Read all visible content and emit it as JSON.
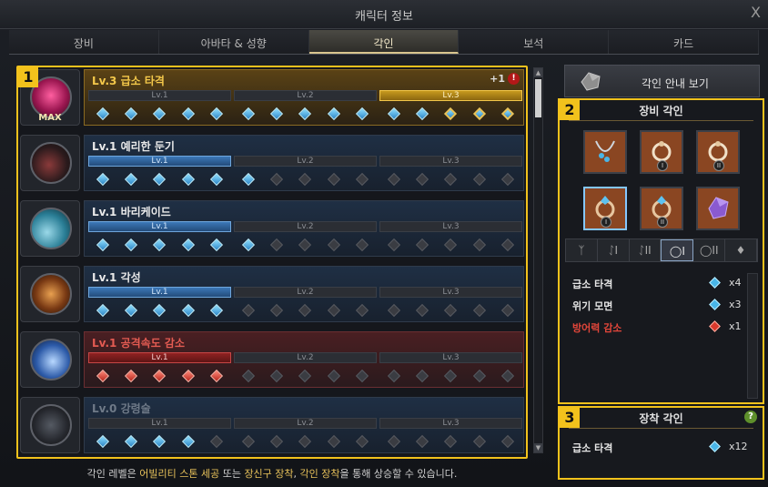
{
  "window": {
    "title": "캐릭터 정보",
    "close_label": "X"
  },
  "tabs": [
    {
      "label": "장비",
      "active": false
    },
    {
      "label": "아바타 & 성향",
      "active": false
    },
    {
      "label": "각인",
      "active": true
    },
    {
      "label": "보석",
      "active": false
    },
    {
      "label": "카드",
      "active": false
    }
  ],
  "callouts": {
    "one": "1",
    "two": "2",
    "three": "3"
  },
  "engravings": [
    {
      "name": "Lv.3 급소 타격",
      "level": 3,
      "max_label": "MAX",
      "bonus": "+1",
      "warn": "!",
      "levels": [
        "Lv.1",
        "Lv.2",
        "Lv.3"
      ],
      "color": "#f4c84a"
    },
    {
      "name": "Lv.1 예리한 둔기",
      "level": 1,
      "levels": [
        "Lv.1",
        "Lv.2",
        "Lv.3"
      ]
    },
    {
      "name": "Lv.1 바리케이드",
      "level": 1,
      "levels": [
        "Lv.1",
        "Lv.2",
        "Lv.3"
      ]
    },
    {
      "name": "Lv.1 각성",
      "level": 1,
      "levels": [
        "Lv.1",
        "Lv.2",
        "Lv.3"
      ]
    },
    {
      "name": "Lv.1 공격속도 감소",
      "level": 1,
      "levels": [
        "Lv.1",
        "Lv.2",
        "Lv.3"
      ],
      "color": "#e35b52"
    },
    {
      "name": "Lv.0 강령술",
      "level": 0,
      "levels": [
        "Lv.1",
        "Lv.2",
        "Lv.3"
      ]
    }
  ],
  "footer": {
    "pre": "각인 레벨은 ",
    "hl1": "어빌리티 스톤 세공",
    "mid1": " 또는 ",
    "hl2": "장신구 장착",
    "mid2": ", ",
    "hl3": "각인 장착",
    "post": "을 통해 상승할 수 있습니다."
  },
  "guide_button": {
    "label": "각인 안내 보기",
    "icon": "stone-icon"
  },
  "equip_panel": {
    "title": "장비 각인",
    "slots": [
      {
        "icon": "necklace-icon",
        "badge": ""
      },
      {
        "icon": "earring-icon",
        "badge": "I"
      },
      {
        "icon": "earring-icon",
        "badge": "II"
      },
      {
        "icon": "ring-icon",
        "badge": "I",
        "selected": true
      },
      {
        "icon": "ring-icon",
        "badge": "II"
      },
      {
        "icon": "ability-stone-icon",
        "badge": ""
      }
    ],
    "filter_tabs": [
      "ᛉ",
      "ᛇI",
      "ᛇII",
      "◯I",
      "◯II",
      "♦"
    ],
    "active_filter": 3,
    "effects": [
      {
        "name": "급소 타격",
        "count": "x4",
        "gem": "blue"
      },
      {
        "name": "위기 모면",
        "count": "x3",
        "gem": "blue"
      },
      {
        "name": "방어력 감소",
        "count": "x1",
        "gem": "red"
      }
    ]
  },
  "equipped_panel": {
    "title": "장착 각인",
    "help": "?",
    "effects": [
      {
        "name": "급소 타격",
        "count": "x12",
        "gem": "blue"
      }
    ]
  },
  "colors": {
    "accent": "#f2c21c",
    "gold_text": "#f4c84a",
    "red_text": "#e35b52",
    "blue_gem": "#2d86c8"
  }
}
